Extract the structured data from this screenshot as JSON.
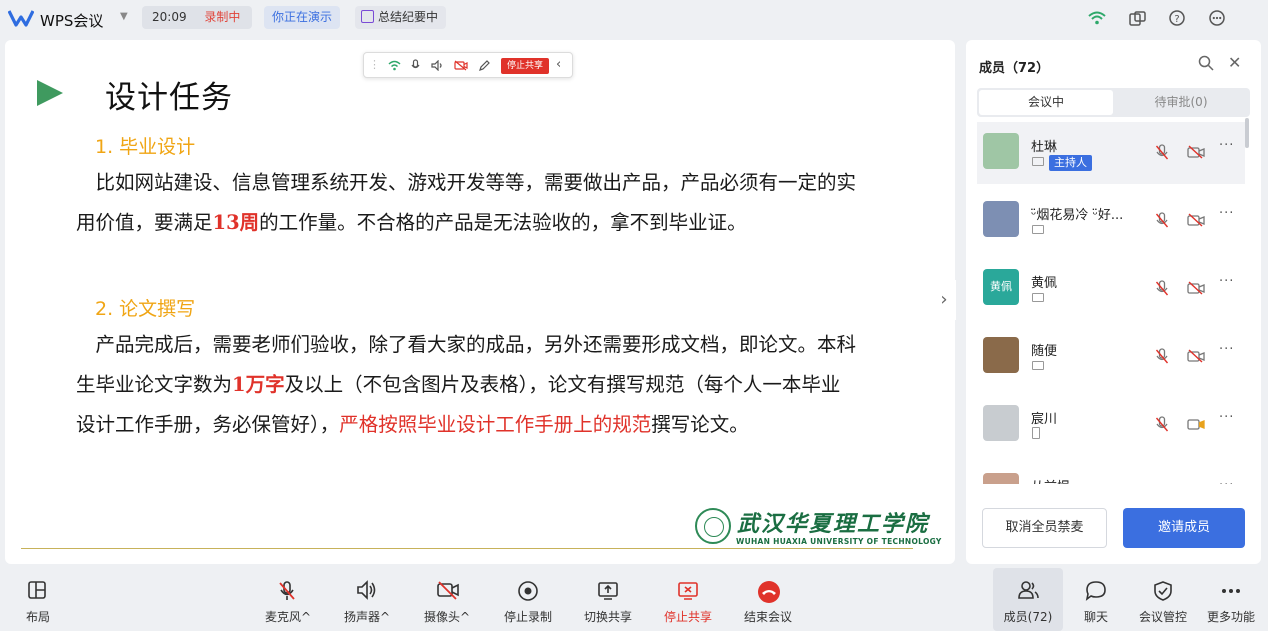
{
  "app": {
    "title": "WPS会议",
    "time": "20:09",
    "recording": "录制中",
    "presenting": "你正在演示",
    "summary": "总结纪要中"
  },
  "top_icons": [
    "wifi-signal-icon",
    "window-switch-icon",
    "help-icon",
    "more-circle-icon"
  ],
  "share_toolbar": {
    "icons": [
      "drag-handle-icon",
      "wifi-icon",
      "mic-icon",
      "speaker-icon",
      "camera-off-icon",
      "pen-icon"
    ],
    "stop_label": "停止共享",
    "collapse": "‹"
  },
  "slide": {
    "title": "设计任务",
    "sections": [
      {
        "heading": "1. 毕业设计",
        "para": [
          {
            "t": "　比如网站建设、信息管理系统开发、游戏开发等等，需要做出产品，产品必须有一定的实用价值，要满足"
          },
          {
            "t": "13周",
            "red": true
          },
          {
            "t": "的工作量。不合格的产品是无法验收的，拿不到毕业证。"
          }
        ]
      },
      {
        "heading": "2. 论文撰写",
        "para": [
          {
            "t": "　产品完成后，需要老师们验收，除了看大家的成品，另外还需要形成文档，即论文。本科生毕业论文字数为"
          },
          {
            "t": "1万字",
            "red": true
          },
          {
            "t": "及以上（不包含图片及表格），论文有撰写规范（每个人一本毕业设计工作手册，务必保管好），"
          },
          {
            "t": "严格按照毕业设计工作手册上的规范",
            "red": true
          },
          {
            "t": "撰写论文。"
          }
        ]
      }
    ],
    "university_cn": "武汉华夏理工学院",
    "university_en": "WUHAN HUAXIA UNIVERSITY OF TECHNOLOGY"
  },
  "panel": {
    "title": "成员（72）",
    "tabs": [
      "会议中",
      "待审批(0)"
    ],
    "members": [
      {
        "name": "杜琳",
        "badge": "主持人",
        "device": "desktop",
        "cam": "off",
        "avatar_color": "#9fc6a5"
      },
      {
        "name": "ᵕ̈烟花易冷 ᵕ̈好...",
        "device": "desktop",
        "cam": "off",
        "avatar_color": "#7d8fb3"
      },
      {
        "name": "黄佩",
        "avatar_text": "黄佩",
        "device": "desktop",
        "cam": "off",
        "avatar_color": "#2aa89a"
      },
      {
        "name": "随便",
        "device": "desktop",
        "cam": "off",
        "avatar_color": "#8a6a4a"
      },
      {
        "name": "宸川",
        "device": "phone",
        "cam": "on",
        "avatar_color": "#c8ccd0"
      },
      {
        "name": "从前慢",
        "device": "desktop",
        "cam": "off",
        "avatar_color": "#c9a08c"
      }
    ],
    "more": "···",
    "unmute_all": "取消全员禁麦",
    "invite": "邀请成员"
  },
  "bottom": {
    "layout": "布局",
    "mic": "麦克风",
    "speaker": "扬声器",
    "camera": "摄像头",
    "stop_record": "停止录制",
    "switch_share": "切换共享",
    "stop_share": "停止共享",
    "end_meeting": "结束会议",
    "members": "成员(72)",
    "chat": "聊天",
    "manage": "会议管控",
    "more": "更多功能",
    "caret": "^"
  },
  "colors": {
    "accent_blue": "#3b6fe0",
    "alert_red": "#e0322a",
    "heading_orange": "#f0a514",
    "slide_arrow_green": "#3f9a5f"
  }
}
